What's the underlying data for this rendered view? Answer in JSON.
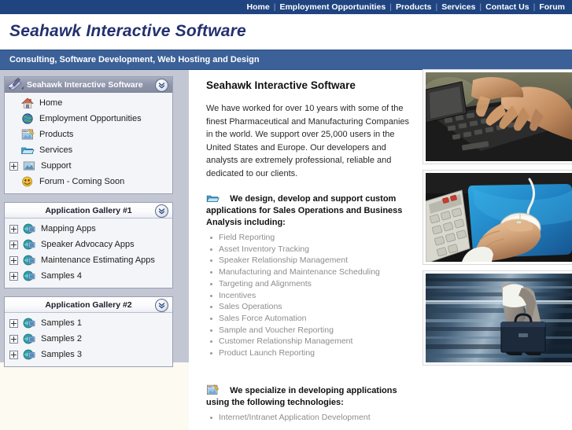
{
  "topnav": {
    "items": [
      "Home",
      "Employment Opportunities",
      "Products",
      "Services",
      "Contact Us",
      "Forum"
    ],
    "separator": "|"
  },
  "brand": {
    "title": "Seahawk Interactive Software",
    "tagline": "Consulting, Software Development, Web Hosting and Design"
  },
  "colors": {
    "topnav_bg": "#1f4480",
    "tagline_bg": "#3c6198",
    "brand_text": "#22316e",
    "sidebar_bg": "#c3c7d4",
    "page_bg": "#fdfaf2",
    "bullet_text": "#8d8d8d"
  },
  "sidebar": {
    "panels": [
      {
        "title": "Seahawk Interactive Software",
        "style": "dark",
        "header_icon": "notepad-pencil-icon",
        "toggle_icon": "chevron-double-down-icon",
        "items": [
          {
            "label": "Home",
            "icon": "house-icon",
            "expandable": false
          },
          {
            "label": "Employment Opportunities",
            "icon": "globe-icon",
            "expandable": false
          },
          {
            "label": "Products",
            "icon": "image-chart-icon",
            "expandable": false
          },
          {
            "label": "Services",
            "icon": "folder-icon",
            "expandable": false
          },
          {
            "label": "Support",
            "icon": "picture-icon",
            "expandable": true
          },
          {
            "label": "Forum - Coming Soon",
            "icon": "smiley-icon",
            "expandable": false
          }
        ]
      },
      {
        "title": "Application Gallery #1",
        "style": "light",
        "toggle_icon": "chevron-double-down-icon",
        "items": [
          {
            "label": "Mapping Apps",
            "icon": "browser-globe-icon",
            "expandable": true
          },
          {
            "label": "Speaker Advocacy Apps",
            "icon": "browser-globe-icon",
            "expandable": true
          },
          {
            "label": "Maintenance Estimating Apps",
            "icon": "browser-globe-icon",
            "expandable": true
          },
          {
            "label": "Samples 4",
            "icon": "browser-globe-icon",
            "expandable": true
          }
        ]
      },
      {
        "title": "Application Gallery #2",
        "style": "light",
        "toggle_icon": "chevron-double-down-icon",
        "items": [
          {
            "label": "Samples 1",
            "icon": "browser-globe-icon",
            "expandable": true
          },
          {
            "label": "Samples 2",
            "icon": "browser-globe-icon",
            "expandable": true
          },
          {
            "label": "Samples 3",
            "icon": "browser-globe-icon",
            "expandable": true
          }
        ]
      }
    ]
  },
  "main": {
    "title": "Seahawk Interactive Software",
    "intro": "We have worked for over 10 years with some of the finest Pharmaceutical and Manufacturing Companies in the world. We support over 25,000 users in the United States and Europe. Our developers and analysts are extremely professional, reliable and dedicated to our clients.",
    "sections": [
      {
        "icon": "folder-icon",
        "heading": "We design, develop and support custom applications for Sales Operations and Business Analysis including:",
        "bullets": [
          "Field Reporting",
          "Asset Inventory Tracking",
          "Speaker Relationship Management",
          "Manufacturing and Maintenance Scheduling",
          "Targeting and Alignments",
          "Incentives",
          "Sales Operations",
          "Sales Force Automation",
          "Sample and Voucher Reporting",
          "Customer Relationship Management",
          "Product Launch Reporting"
        ]
      },
      {
        "icon": "image-chart-icon",
        "heading": "We specialize in developing applications using the following technologies:",
        "bullets": [
          "Internet/Intranet Application Development"
        ]
      }
    ]
  },
  "photos": [
    {
      "name": "hands-typing-on-laptop-keyboard-photo"
    },
    {
      "name": "hand-on-mouse-with-blue-mousepad-photo"
    },
    {
      "name": "businessperson-walking-with-briefcase-photo"
    }
  ]
}
